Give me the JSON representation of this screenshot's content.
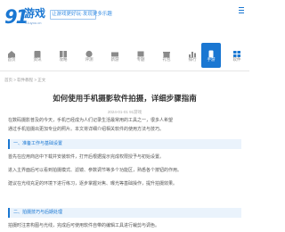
{
  "header": {
    "logo_mark": "91",
    "logo_cn": "游戏",
    "logo_sub": "91uyou.cn",
    "slogan": "让游戏更好玩·发现更多乐趣"
  },
  "nav": {
    "items": [
      {
        "label": "首页",
        "icon": "home-icon"
      },
      {
        "label": "资讯",
        "icon": "news-icon"
      },
      {
        "label": "攻略",
        "icon": "guide-icon"
      },
      {
        "label": "评测",
        "icon": "review-icon"
      },
      {
        "label": "新游",
        "icon": "new-game-icon"
      },
      {
        "label": "专题",
        "icon": "topic-icon"
      },
      {
        "label": "礼包",
        "icon": "gift-icon"
      },
      {
        "label": "排行",
        "icon": "rank-icon"
      },
      {
        "label": "手游",
        "icon": "mobile-icon"
      },
      {
        "label": "软件",
        "icon": "app-icon"
      }
    ],
    "active_index": 8
  },
  "breadcrumb": "首页 > 软件教程 > 正文",
  "article": {
    "title": "如何使用手机摄影软件拍摄，详细步骤指南",
    "meta": "2024-01-01  91游戏",
    "intro_lines": [
      "    在数码摄影普及的今天，手机已经成为人们记录生活最常用的工具之一，很多人希望",
      "通过手机拍摄出更加专业的照片。本文将详细介绍相关软件的使用方法与技巧。"
    ],
    "section1": "一、准备工作与基础设置",
    "section1_lines": [
      "    首先在应用商店中下载并安装软件，打开后根据提示完成权限授予与初始设置。",
      "    进入主界面后可以看到拍摄模式、滤镜、参数调节等多个功能区，熟悉各个按钮的作用。",
      "    建议在光线充足的环境下进行练习，逐步掌握对焦、曝光等基础操作，提升拍摄效果。"
    ],
    "section2": "二、拍摄技巧与后期处理",
    "section2_lines": [
      "    拍摄时注意构图与光线，完成后可使用软件自带的编辑工具进行裁剪与调色。"
    ]
  },
  "colors": {
    "accent": "#1a77d2"
  }
}
